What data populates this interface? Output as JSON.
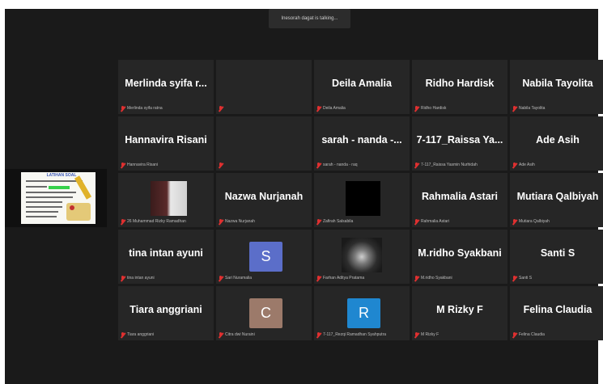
{
  "banner": {
    "text": "Inesorah dagat is talking..."
  },
  "shared_screen": {
    "title": "LATIHAN SOAL"
  },
  "colors": {
    "background": "#1a1a1a",
    "tile": "#262626",
    "muted_mic": "#e03030"
  },
  "participants": [
    {
      "name": "Merlinda syifa r...",
      "sub": "Merlinda syifa ratna"
    },
    {
      "name": "",
      "sub": ""
    },
    {
      "name": "Deila Amalia",
      "sub": "Deila Amalia"
    },
    {
      "name": "Ridho Hardisk",
      "sub": "Ridho Hardisk"
    },
    {
      "name": "Nabila Tayolita",
      "sub": "Nabila Tayolita"
    },
    {
      "name": "Hannavira Risani",
      "sub": "Hannavira Risani"
    },
    {
      "name": "",
      "sub": ""
    },
    {
      "name": "sarah - nanda -...",
      "sub": "sarah - nanda - raq"
    },
    {
      "name": "7-117_Raissa  Ya...",
      "sub": "7-117_Raissa Yasmin Nurhidah"
    },
    {
      "name": "Ade Asih",
      "sub": "Ade Asih"
    },
    {
      "name": "",
      "sub": "26 Muhammad Rizky Ramadhan"
    },
    {
      "name": "Nazwa Nurjanah",
      "sub": "Nazwa Nurjanah"
    },
    {
      "name": "",
      "sub": "Zafirah Salsabila"
    },
    {
      "name": "Rahmalia Astari",
      "sub": "Rahmalia Astari"
    },
    {
      "name": "Mutiara Qalbiyah",
      "sub": "Mutiara Qalbiyah"
    },
    {
      "name": "tina intan ayuni",
      "sub": "tina intan ayuni"
    },
    {
      "name": "",
      "sub": "Sari Nuramalia",
      "avatar": "S"
    },
    {
      "name": "",
      "sub": "Farhan Aditya Pratama"
    },
    {
      "name": "M.ridho Syakbani",
      "sub": "M.ridho Syakbani"
    },
    {
      "name": "Santi S",
      "sub": "Santi S"
    },
    {
      "name": "Tiara anggriani",
      "sub": "Tiara anggriani"
    },
    {
      "name": "",
      "sub": "Citra dwi Nuraini",
      "avatar": "C"
    },
    {
      "name": "",
      "sub": "7-117_Rezqi Ramadhan Syahputra",
      "avatar": "R"
    },
    {
      "name": "M Rizky F",
      "sub": "M Rizky F"
    },
    {
      "name": "Felina Claudia",
      "sub": "Felina Claudia"
    }
  ]
}
